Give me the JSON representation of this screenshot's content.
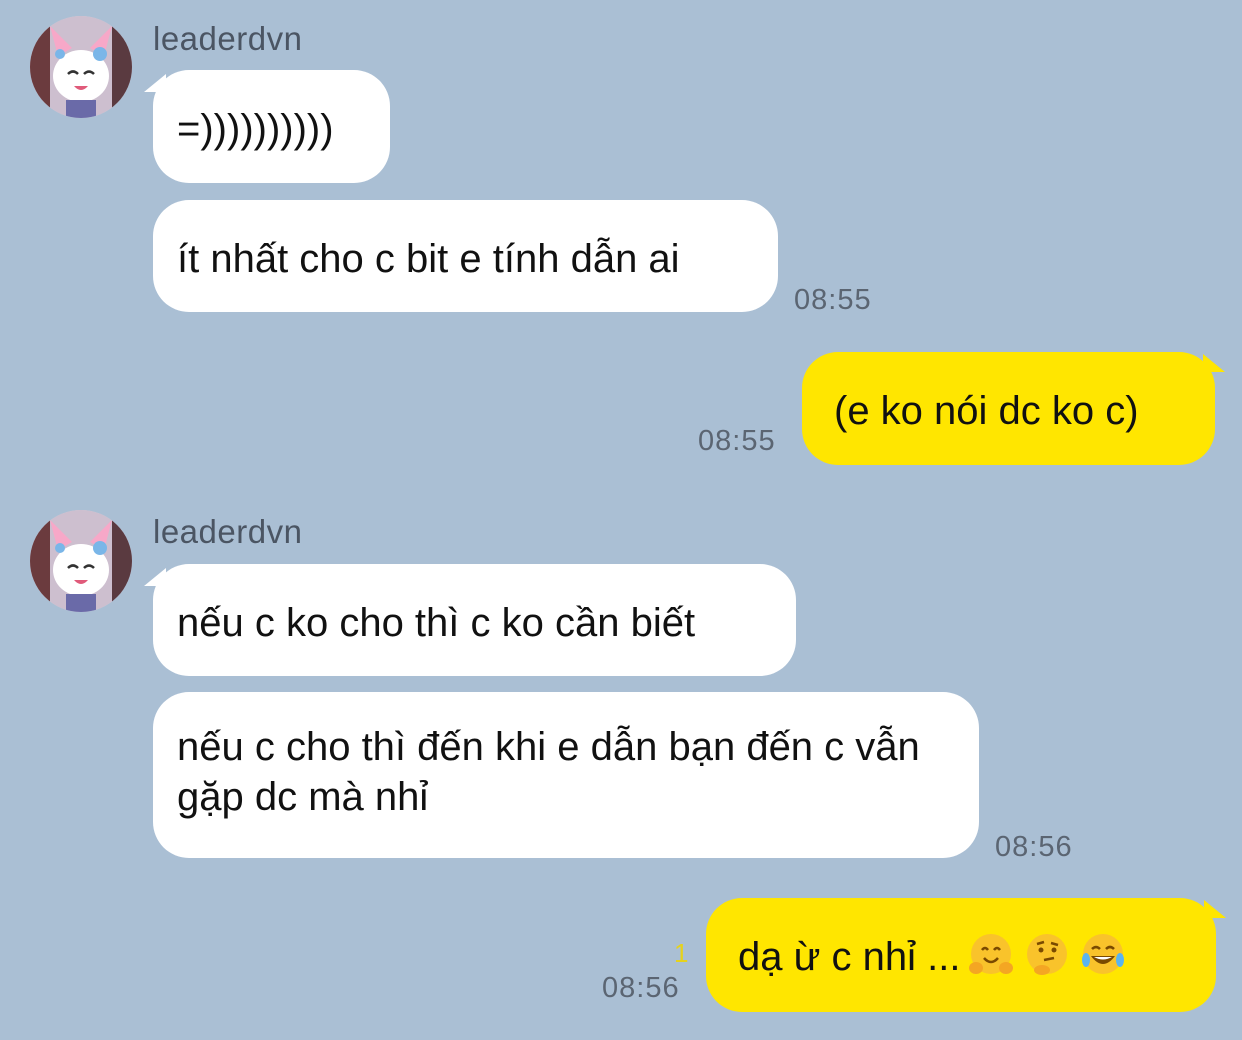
{
  "colors": {
    "background": "#aabfd4",
    "incoming_bubble": "#ffffff",
    "outgoing_bubble": "#ffe600",
    "timestamp": "#5b6572",
    "read_count": "#e6d21c"
  },
  "messages": [
    {
      "direction": "incoming",
      "sender": "leaderdvn",
      "avatar_icon": "sylveon-avatar",
      "bubbles": [
        "=))))))))))",
        "ít nhất cho c bit e tính dẫn ai"
      ],
      "time": "08:55"
    },
    {
      "direction": "outgoing",
      "bubbles": [
        "(e ko nói dc ko c)"
      ],
      "time": "08:55"
    },
    {
      "direction": "incoming",
      "sender": "leaderdvn",
      "avatar_icon": "sylveon-avatar",
      "bubbles": [
        "nếu c ko cho thì c ko cần biết",
        "nếu c cho thì đến khi e dẫn bạn đến c vẫn gặp dc mà nhỉ"
      ],
      "time": "08:56"
    },
    {
      "direction": "outgoing",
      "bubbles": [
        "dạ ừ c nhỉ ..."
      ],
      "emojis": [
        "hugging-face-emoji",
        "thinking-face-emoji",
        "tears-of-joy-emoji"
      ],
      "read_count": "1",
      "time": "08:56"
    }
  ]
}
